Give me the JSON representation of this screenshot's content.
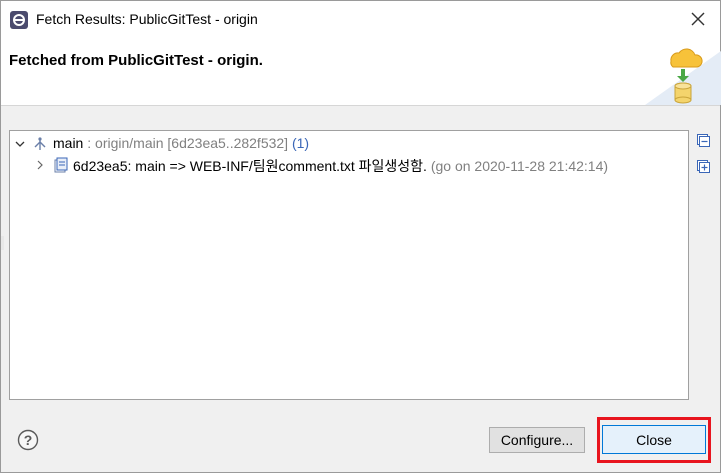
{
  "window": {
    "title": "Fetch Results: PublicGitTest - origin"
  },
  "header": {
    "title": "Fetched from PublicGitTest - origin."
  },
  "tree": {
    "ref": {
      "name": "main",
      "separator": " : ",
      "remote": "origin/main",
      "range": "[6d23ea5..282f532]",
      "count": "(1)"
    },
    "commit": {
      "summary": "6d23ea5: main => WEB-INF/팀원comment.txt 파일생성함.",
      "meta": "(go on 2020-11-28 21:42:14)"
    }
  },
  "buttons": {
    "configure": "Configure...",
    "close": "Close"
  },
  "colors": {
    "highlight": "#e8141e",
    "ref_blue": "#3a66b7"
  },
  "icons": {
    "app": "eclipse-icon",
    "close": "close-icon",
    "wizard": "cloud-fetch-database-icon",
    "branch": "branch-icon",
    "commit": "commit-icon",
    "collapse_all": "collapse-all-icon",
    "expand_all": "expand-all-icon",
    "help": "help-icon"
  }
}
